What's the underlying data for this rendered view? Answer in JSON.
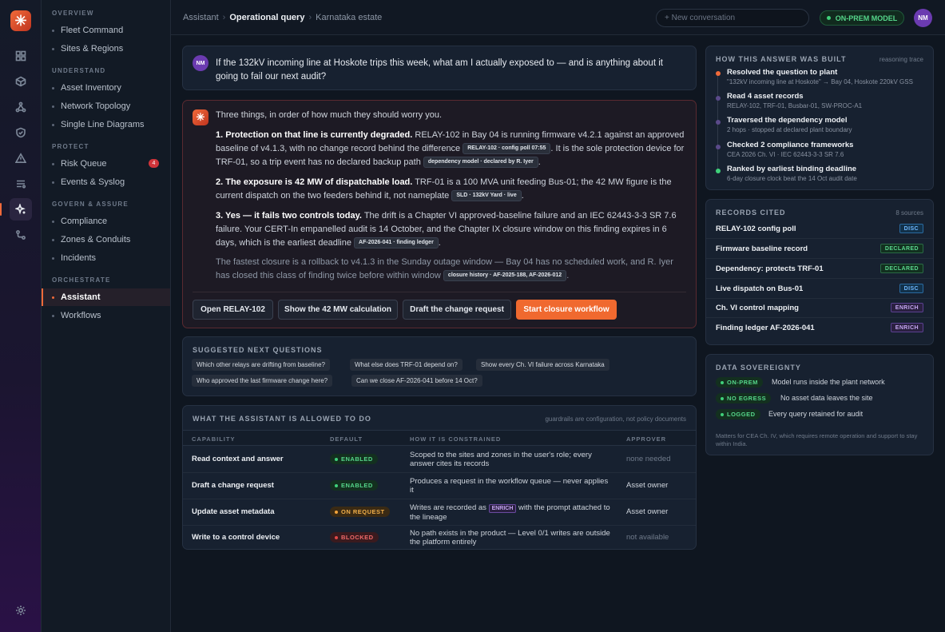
{
  "app": {
    "logo": "✳"
  },
  "rail": {
    "icons": [
      "grid-icon",
      "cube-icon",
      "topology-icon",
      "shield-icon",
      "alert-icon",
      "list-icon",
      "sparkle-icon",
      "route-icon"
    ],
    "settings_icon": "gear-icon"
  },
  "sidebar": {
    "sections": [
      {
        "label": "OVERVIEW",
        "items": [
          "Fleet Command",
          "Sites & Regions"
        ]
      },
      {
        "label": "UNDERSTAND",
        "items": [
          "Asset Inventory",
          "Network Topology",
          "Single Line Diagrams"
        ]
      },
      {
        "label": "PROTECT",
        "items": [
          "Risk Queue",
          "Events & Syslog"
        ]
      },
      {
        "label": "GOVERN & ASSURE",
        "items": [
          "Compliance",
          "Zones & Conduits",
          "Incidents"
        ]
      },
      {
        "label": "ORCHESTRATE",
        "items": [
          "Assistant",
          "Workflows"
        ]
      }
    ],
    "risk_badge": "4",
    "active": "Assistant"
  },
  "header": {
    "breadcrumb": [
      "Assistant",
      "Operational query",
      "Karnataka estate"
    ],
    "search_placeholder": "+ New conversation",
    "status": "ON-PREM MODEL",
    "user_initials": "NM"
  },
  "question": {
    "initials": "NM",
    "text": "If the 132kV incoming line at Hoskote trips this week, what am I actually exposed to — and is anything about it going to fail our next audit?"
  },
  "answer": {
    "intro": "Three things, in order of how much they should worry you.",
    "p1": {
      "bold": "1. Protection on that line is currently degraded.",
      "text": " RELAY-102 in Bay 04 is running firmware v4.2.1 against an approved baseline of v4.1.3, with no change record behind the difference ",
      "tag1": "RELAY-102 · config poll 07:55",
      "text2": ". It is the sole protection device for TRF-01, so a trip event has no declared backup path ",
      "tag2": "dependency model · declared by R. Iyer",
      "end": "."
    },
    "p2": {
      "bold": "2. The exposure is 42 MW of dispatchable load.",
      "text": " TRF-01 is a 100 MVA unit feeding Bus-01; the 42 MW figure is the current dispatch on the two feeders behind it, not nameplate ",
      "tag1": "SLD · 132kV Yard · live",
      "end": "."
    },
    "p3": {
      "bold": "3. Yes — it fails two controls today.",
      "text": " The drift is a Chapter VI approved-baseline failure and an IEC 62443-3-3 SR 7.6 failure. Your CERT-In empanelled audit is 14 October, and the Chapter IX closure window on this finding expires in 6 days, which is the earliest deadline ",
      "tag1": "AF-2026-041 · finding ledger",
      "end": "."
    },
    "p4": {
      "text": "The fastest closure is a rollback to v4.1.3 in the Sunday outage window — Bay 04 has no scheduled work, and R. Iyer has closed this class of finding twice before within window ",
      "tag1": "closure history · AF-2025-188, AF-2026-012",
      "end": "."
    },
    "buttons": [
      "Open RELAY-102",
      "Show the 42 MW calculation",
      "Draft the change request",
      "Start closure workflow"
    ]
  },
  "suggested": {
    "title": "SUGGESTED NEXT QUESTIONS",
    "chips": [
      "Which other relays are drifting from baseline?",
      "What else does TRF-01 depend on?",
      "Show every Ch. VI failure across Karnataka",
      "Who approved the last firmware change here?",
      "Can we close AF-2026-041 before 14 Oct?"
    ]
  },
  "capabilities": {
    "title": "WHAT THE ASSISTANT IS ALLOWED TO DO",
    "note": "guardrails are configuration, not policy documents",
    "headers": [
      "CAPABILITY",
      "DEFAULT",
      "HOW IT IS CONSTRAINED",
      "APPROVER"
    ],
    "rows": [
      {
        "cap": "Read context and answer",
        "status": "ENABLED",
        "how": "Scoped to the sites and zones in the user's role; every answer cites its records",
        "approver": "none needed"
      },
      {
        "cap": "Draft a change request",
        "status": "ENABLED",
        "how": "Produces a request in the workflow queue — never applies it",
        "approver": "Asset owner"
      },
      {
        "cap": "Update asset metadata",
        "status": "ON REQUEST",
        "how_a": "Writes are recorded as",
        "how_tag": "ENRICH",
        "how_b": "with the prompt attached to the lineage",
        "approver": "Asset owner"
      },
      {
        "cap": "Write to a control device",
        "status": "BLOCKED",
        "how": "No path exists in the product — Level 0/1 writes are outside the platform entirely",
        "approver": "not available"
      }
    ]
  },
  "how": {
    "title": "HOW THIS ANSWER WAS BUILT",
    "right": "reasoning trace",
    "steps": [
      {
        "t": "Resolved the question to plant",
        "s": "\"132kV incoming line at Hoskote\" → Bay 04, Hoskote 220kV GSS",
        "color": "#f06a3a"
      },
      {
        "t": "Read 4 asset records",
        "s": "RELAY-102, TRF-01, Busbar-01, SW-PROC-A1",
        "color": "#5a4a8a"
      },
      {
        "t": "Traversed the dependency model",
        "s": "2 hops · stopped at declared plant boundary",
        "color": "#5a4a8a"
      },
      {
        "t": "Checked 2 compliance frameworks",
        "s": "CEA 2026 Ch. VI · IEC 62443-3-3 SR 7.6",
        "color": "#5a4a8a"
      },
      {
        "t": "Ranked by earliest binding deadline",
        "s": "6-day closure clock beat the 14 Oct audit date",
        "color": "#3fd07a"
      }
    ]
  },
  "records": {
    "title": "RECORDS CITED",
    "right": "8 sources",
    "rows": [
      {
        "name": "RELAY-102 config poll",
        "badge": "DISC"
      },
      {
        "name": "Firmware baseline record",
        "badge": "DECLARED"
      },
      {
        "name": "Dependency: protects TRF-01",
        "badge": "DECLARED"
      },
      {
        "name": "Live dispatch on Bus-01",
        "badge": "DISC"
      },
      {
        "name": "Ch. VI control mapping",
        "badge": "ENRICH"
      },
      {
        "name": "Finding ledger AF-2026-041",
        "badge": "ENRICH"
      }
    ]
  },
  "sovereignty": {
    "title": "DATA SOVEREIGNTY",
    "rows": [
      {
        "pill": "ON-PREM",
        "text": "Model runs inside the plant network"
      },
      {
        "pill": "NO EGRESS",
        "text": "No asset data leaves the site"
      },
      {
        "pill": "LOGGED",
        "text": "Every query retained for audit"
      }
    ],
    "foot": "Matters for CEA Ch. IV, which requires remote operation and support to stay within India."
  },
  "colors": {
    "accent": "#f06a3a",
    "enabled": "#3fd07a",
    "on_request": "#f2a33a",
    "blocked": "#e04848"
  }
}
